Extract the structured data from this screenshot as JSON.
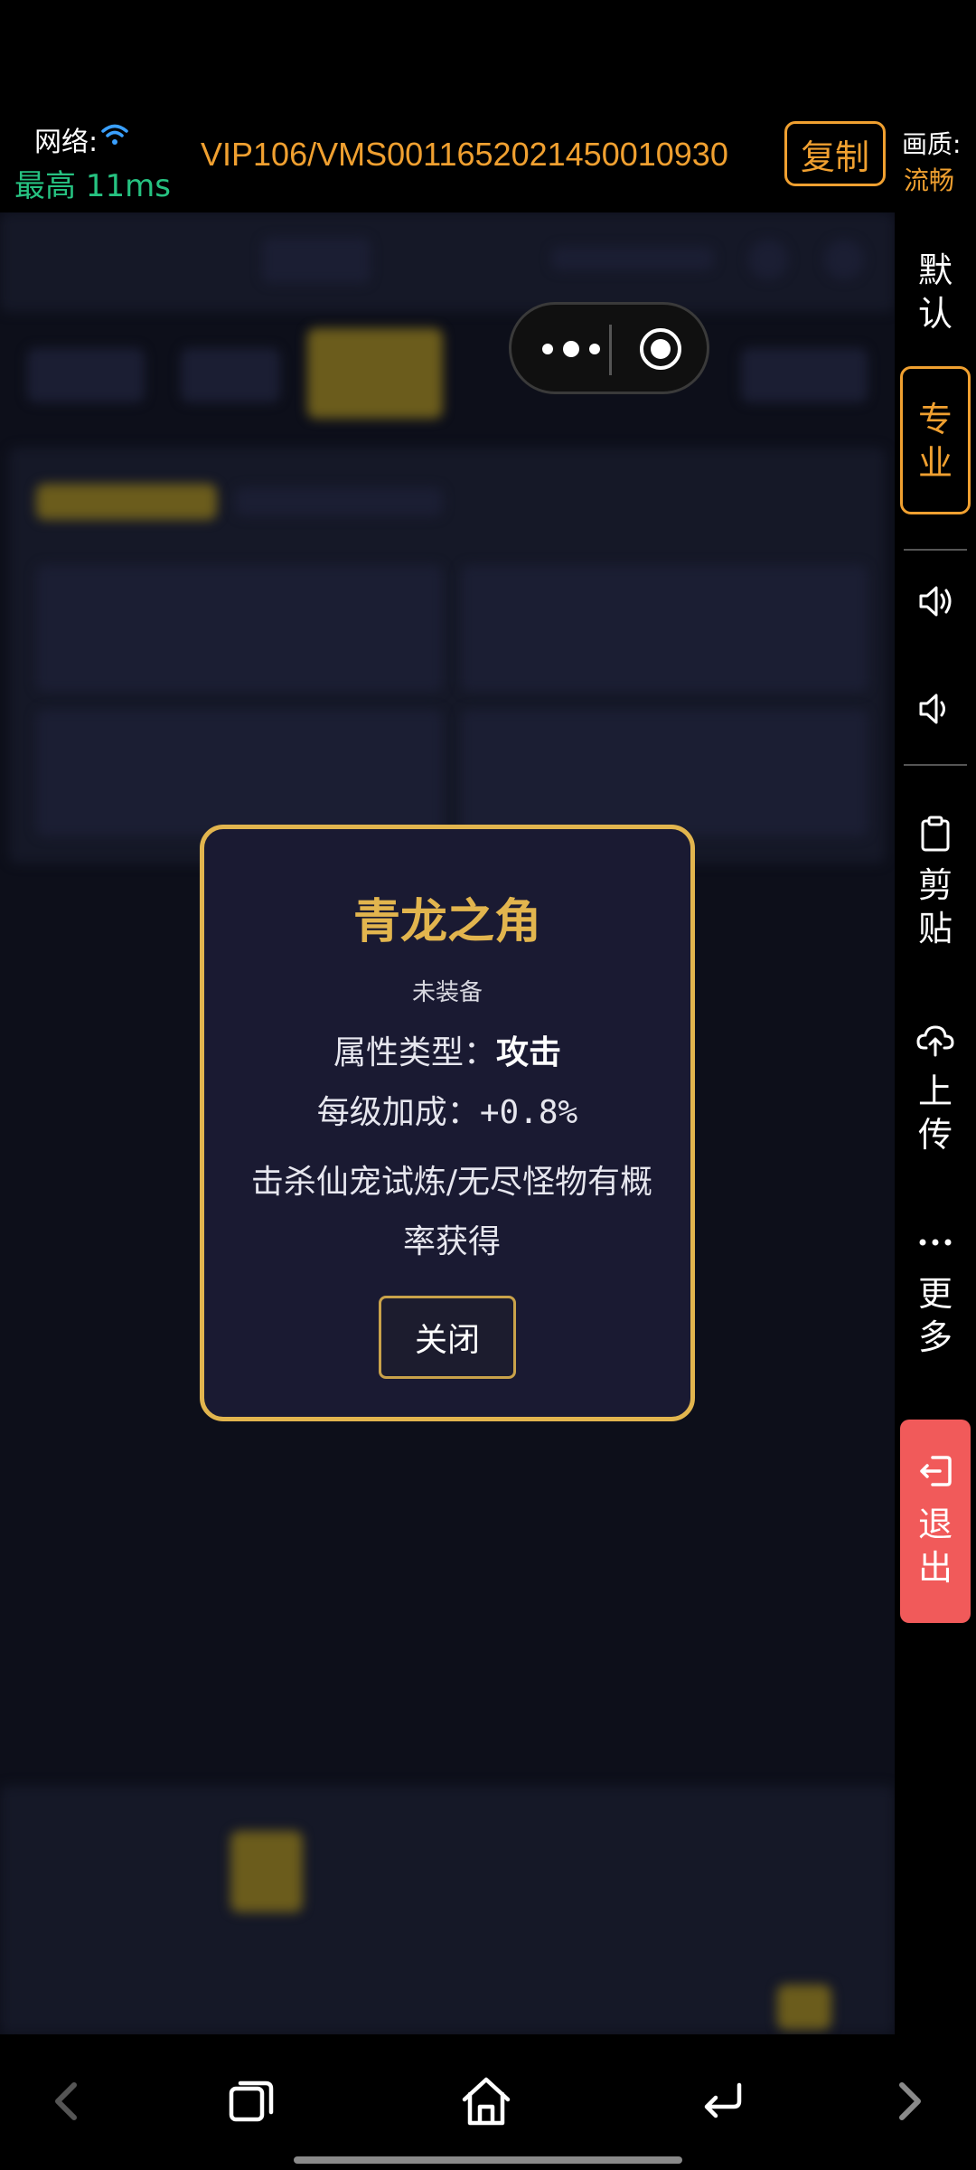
{
  "topbar": {
    "network_label": "网络:",
    "latency": "最高 11ms",
    "session_id": "VIP106/VMS0011652021450010930",
    "copy_label": "复制",
    "quality_label": "画质:",
    "quality_value": "流畅"
  },
  "modal": {
    "title": "青龙之角",
    "status": "未装备",
    "attr_label": "属性类型：",
    "attr_value": "攻击",
    "bonus_label": "每级加成：",
    "bonus_value": "+0.8%",
    "description": "击杀仙宠试炼/无尽怪物有概率获得",
    "close_label": "关闭"
  },
  "sidebar": {
    "default_label": "默认",
    "pro_label": "专业",
    "paste_label": "剪贴",
    "upload_label": "上传",
    "more_label": "更多",
    "exit_label": "退出"
  },
  "colors": {
    "accent": "#f0a030",
    "latency": "#26c281",
    "modal_border": "#e2b54e",
    "exit_bg": "#f15a5a"
  },
  "icons": {
    "wifi": "wifi-icon",
    "capsule_more": "more-dots-icon",
    "capsule_record": "record-icon",
    "volume_up": "volume-up-icon",
    "volume_down": "volume-down-icon",
    "paste": "clipboard-icon",
    "upload": "cloud-upload-icon",
    "more": "ellipsis-icon",
    "exit": "exit-icon",
    "back": "chevron-left-icon",
    "recents": "recents-icon",
    "home": "home-icon",
    "return": "return-icon",
    "forward": "chevron-right-icon"
  }
}
